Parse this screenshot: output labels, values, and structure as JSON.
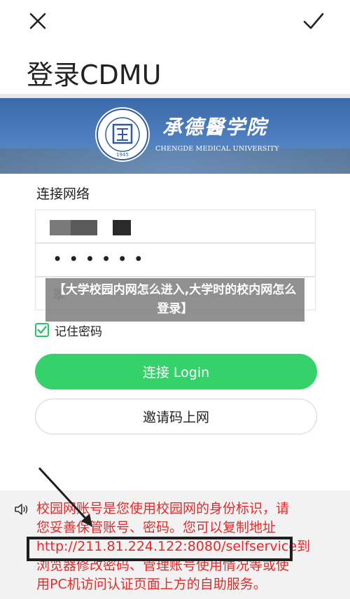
{
  "header": {
    "close_icon": "close-icon",
    "confirm_icon": "check-icon",
    "title": "登录CDMU"
  },
  "banner": {
    "logo_year": "1945",
    "university_cn": "承德醫学院",
    "university_en": "CHENGDE MEDICAL UNIVERSITY"
  },
  "form": {
    "section_label": "连接网络",
    "password_masked": "••••••",
    "third_field_text": "翠",
    "remember_label": "记住密码",
    "remember_checked": true,
    "login_button": "连接 Login",
    "invite_button": "邀请码上网"
  },
  "notice": {
    "icon": "speaker-icon",
    "line1": "校园网账号是您使用校园网的身份标识，请",
    "line2": "您妥善保管账号、密码。您可以复制地址",
    "line3": "http://211.81.224.122:8080/selfservice到",
    "line4": "浏览器修改密码、管理账号使用情况等或使",
    "line5": "用PC机访问认证页面上方的自助服务。"
  },
  "overlay": {
    "caption": "【大学校园内网怎么进入,大学时的校内网怎么登录】"
  },
  "colors": {
    "accent_green": "#35d16a",
    "notice_red": "#e32a2a",
    "banner_blue": "#4e7fc0"
  }
}
